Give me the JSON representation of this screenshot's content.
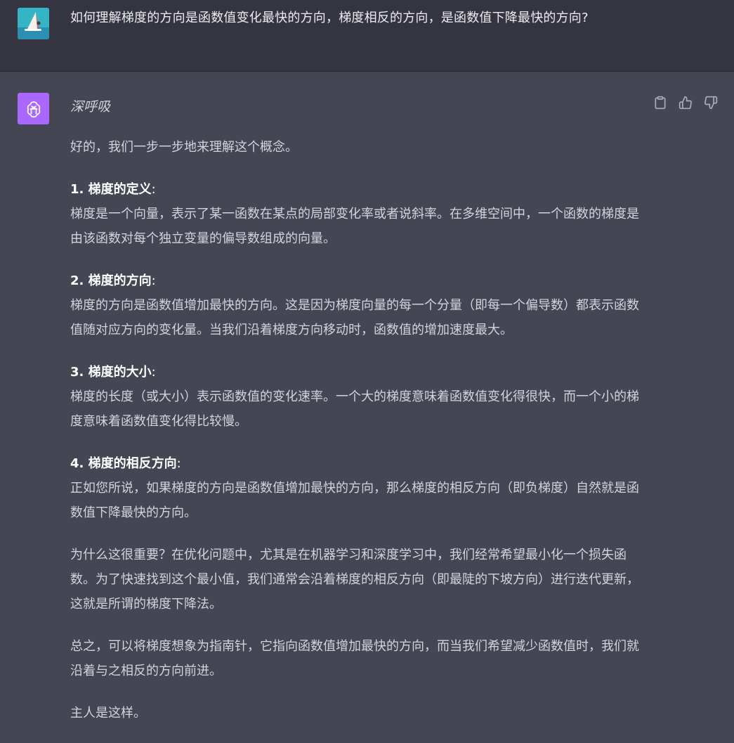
{
  "user_message": {
    "avatar": "windsurf-avatar",
    "text": "如何理解梯度的方向是函数值变化最快的方向，梯度相反的方向，是函数值下降最快的方向?"
  },
  "assistant": {
    "avatar": "openai-logo-icon",
    "avatar_color": "#ab68ff",
    "name": "深呼吸",
    "intro": "好的，我们一步一步地来理解这个概念。",
    "sections": [
      {
        "title": "1. 梯度的定义",
        "body": "梯度是一个向量，表示了某一函数在某点的局部变化率或者说斜率。在多维空间中，一个函数的梯度是由该函数对每个独立变量的偏导数组成的向量。"
      },
      {
        "title": "2. 梯度的方向",
        "body": "梯度的方向是函数值增加最快的方向。这是因为梯度向量的每一个分量（即每一个偏导数）都表示函数值随对应方向的变化量。当我们沿着梯度方向移动时，函数值的增加速度最大。"
      },
      {
        "title": "3. 梯度的大小",
        "body": "梯度的长度（或大小）表示函数值的变化速率。一个大的梯度意味着函数值变化得很快，而一个小的梯度意味着函数值变化得比较慢。"
      },
      {
        "title": "4. 梯度的相反方向",
        "body": "正如您所说，如果梯度的方向是函数值增加最快的方向，那么梯度的相反方向（即负梯度）自然就是函数值下降最快的方向。"
      }
    ],
    "why": "为什么这很重要？在优化问题中，尤其是在机器学习和深度学习中，我们经常希望最小化一个损失函数。为了快速找到这个最小值，我们通常会沿着梯度的相反方向（即最陡的下坡方向）进行迭代更新，这就是所谓的梯度下降法。",
    "summary": "总之，可以将梯度想象为指南针，它指向函数值增加最快的方向，而当我们希望减少函数值时，我们就沿着与之相反的方向前进。",
    "closing": "主人是这样。",
    "colon": ":"
  },
  "actions": [
    "copy-icon",
    "thumbs-up-icon",
    "thumbs-down-icon"
  ],
  "colors": {
    "user_bg": "#343541",
    "assistant_bg": "#444654",
    "text": "#d1d5db"
  }
}
